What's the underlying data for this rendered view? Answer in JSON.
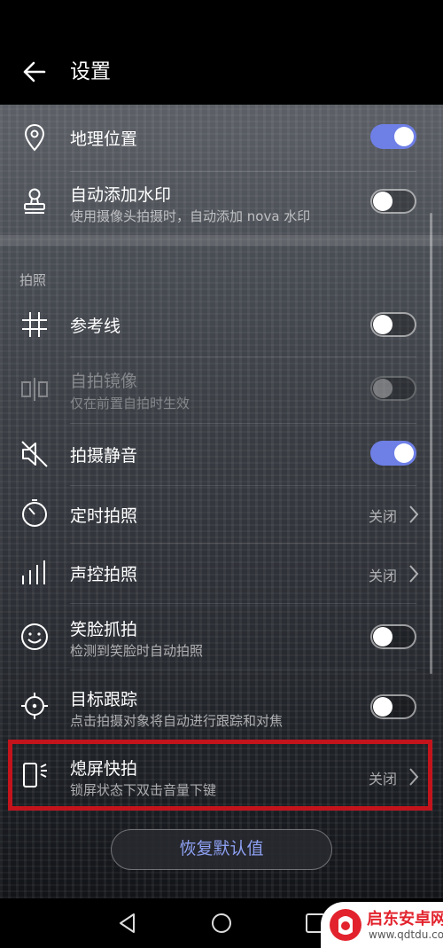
{
  "header": {
    "title": "设置"
  },
  "rows": {
    "location": {
      "label": "地理位置",
      "toggle": "on"
    },
    "watermark": {
      "label": "自动添加水印",
      "sub": "使用摄像头拍摄时，自动添加 nova 水印",
      "toggle": "off"
    },
    "section": "拍照",
    "gridlines": {
      "label": "参考线",
      "toggle": "off"
    },
    "mirror": {
      "label": "自拍镜像",
      "sub": "仅在前置自拍时生效",
      "toggle": "off-disabled"
    },
    "mute": {
      "label": "拍摄静音",
      "toggle": "on"
    },
    "timer": {
      "label": "定时拍照",
      "value": "关闭"
    },
    "voice": {
      "label": "声控拍照",
      "value": "关闭"
    },
    "smile": {
      "label": "笑脸抓拍",
      "sub": "检测到笑脸时自动拍照",
      "toggle": "off"
    },
    "tracking": {
      "label": "目标跟踪",
      "sub": "点击拍摄对象将自动进行跟踪和对焦",
      "toggle": "off"
    },
    "ultra_snapshot": {
      "label": "熄屏快拍",
      "sub": "锁屏状态下双击音量下键",
      "value": "关闭"
    }
  },
  "restore_button": "恢复默认值",
  "watermark_site": {
    "name": "启东安卓网",
    "url": "www.qdtdu.com"
  },
  "colors": {
    "toggle_on": "#6e7fe6",
    "highlight": "#c3141c",
    "button_text": "#8ea0f2"
  }
}
